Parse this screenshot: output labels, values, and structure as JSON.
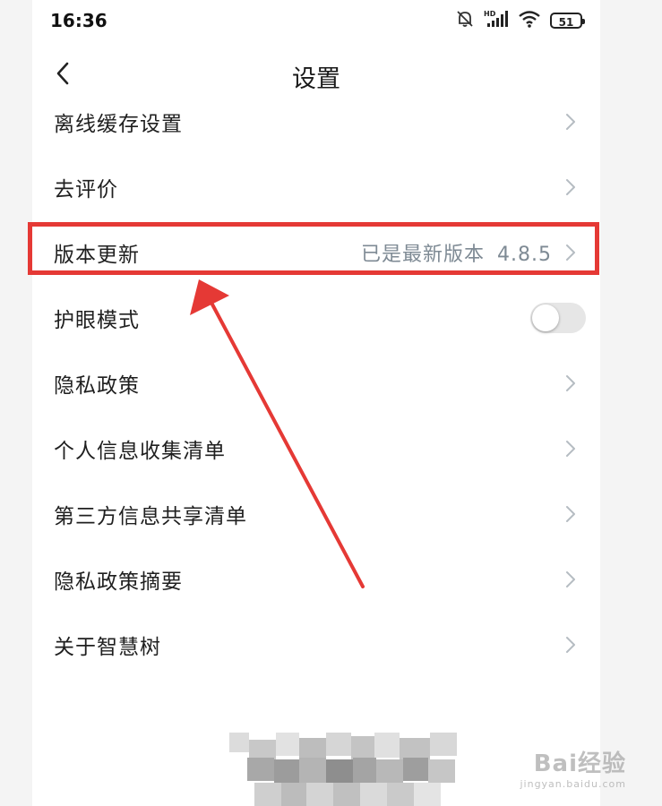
{
  "status_bar": {
    "time": "16:36",
    "battery": "51",
    "network": "HD",
    "icons": [
      "mute-bell-icon",
      "signal-icon",
      "wifi-icon",
      "battery-icon"
    ]
  },
  "nav": {
    "title": "设置",
    "back_icon": "chevron-left-icon"
  },
  "settings": {
    "items": [
      {
        "label": "离线缓存设置",
        "control": "chevron"
      },
      {
        "label": "去评价",
        "control": "chevron"
      },
      {
        "label": "版本更新",
        "status": "已是最新版本",
        "version": "4.8.5",
        "control": "chevron",
        "highlighted": true
      },
      {
        "label": "护眼模式",
        "control": "toggle",
        "toggle_on": false
      },
      {
        "label": "隐私政策",
        "control": "chevron"
      },
      {
        "label": "个人信息收集清单",
        "control": "chevron"
      },
      {
        "label": "第三方信息共享清单",
        "control": "chevron"
      },
      {
        "label": "隐私政策摘要",
        "control": "chevron"
      },
      {
        "label": "关于智慧树",
        "control": "chevron"
      }
    ]
  },
  "annotation": {
    "color": "#e53935"
  },
  "watermark": {
    "brand": "Bai经验",
    "url": "jingyan.baidu.com"
  },
  "colors": {
    "status_text": "#7e8a94",
    "toggle_off": "#e6e6e6"
  }
}
